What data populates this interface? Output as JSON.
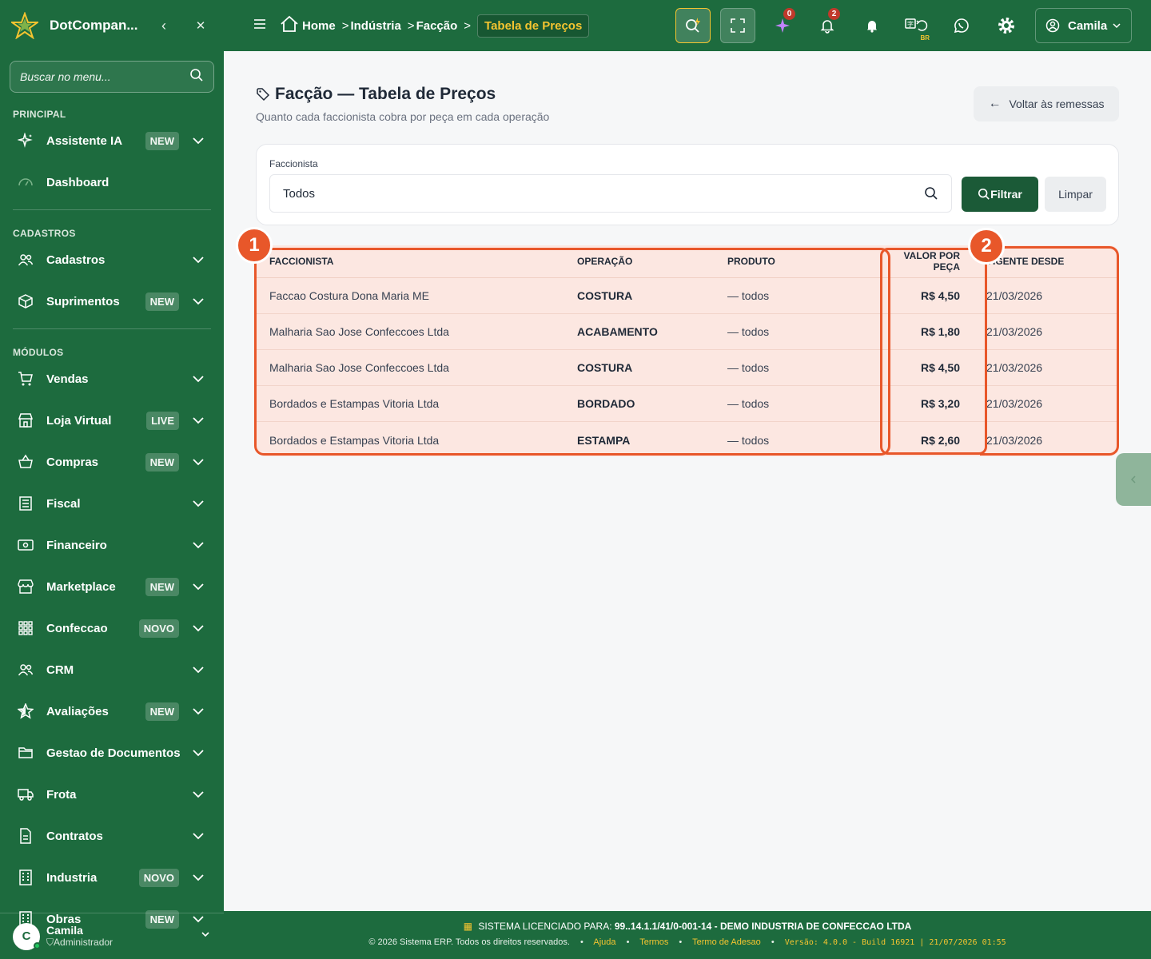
{
  "sidebar": {
    "brand": "DotCompan...",
    "search_placeholder": "Buscar no menu...",
    "sections": {
      "principal": "PRINCIPAL",
      "cadastros": "CADASTROS",
      "modulos": "MÓDULOS"
    },
    "items": [
      {
        "label": "Assistente IA",
        "badge": "NEW",
        "icon": "sparkles-icon"
      },
      {
        "label": "Dashboard",
        "badge": "",
        "icon": "gauge-icon"
      },
      {
        "label": "Cadastros",
        "badge": "",
        "icon": "users-icon"
      },
      {
        "label": "Suprimentos",
        "badge": "NEW",
        "icon": "box-icon"
      },
      {
        "label": "Vendas",
        "badge": "",
        "icon": "cart-icon"
      },
      {
        "label": "Loja Virtual",
        "badge": "LIVE",
        "icon": "store-icon"
      },
      {
        "label": "Compras",
        "badge": "NEW",
        "icon": "basket-icon"
      },
      {
        "label": "Fiscal",
        "badge": "",
        "icon": "receipt-icon"
      },
      {
        "label": "Financeiro",
        "badge": "",
        "icon": "money-icon"
      },
      {
        "label": "Marketplace",
        "badge": "NEW",
        "icon": "shop-icon"
      },
      {
        "label": "Confeccao",
        "badge": "NOVO",
        "icon": "grid-icon"
      },
      {
        "label": "CRM",
        "badge": "",
        "icon": "users-icon"
      },
      {
        "label": "Avaliações",
        "badge": "NEW",
        "icon": "star-icon"
      },
      {
        "label": "Gestao de Documentos",
        "badge": "",
        "icon": "folder-icon"
      },
      {
        "label": "Frota",
        "badge": "",
        "icon": "truck-icon"
      },
      {
        "label": "Contratos",
        "badge": "",
        "icon": "file-icon"
      },
      {
        "label": "Industria",
        "badge": "NOVO",
        "icon": "building-icon"
      },
      {
        "label": "Obras",
        "badge": "NEW",
        "icon": "building-icon"
      }
    ],
    "user": {
      "initial": "C",
      "name": "Camila",
      "role": "Administrador"
    }
  },
  "topbar": {
    "breadcrumb": [
      "Home",
      "Indústria",
      "Facção"
    ],
    "breadcrumb_active": "Tabela de Preços",
    "badge_ai": "0",
    "badge_notif": "2",
    "lang": "BR",
    "user": "Camila"
  },
  "page": {
    "title": "Facção — Tabela de Preços",
    "subtitle": "Quanto cada faccionista cobra por peça em cada operação",
    "back_button": "Voltar às remessas"
  },
  "filter": {
    "label": "Faccionista",
    "value": "Todos",
    "filter_button": "Filtrar",
    "clear_button": "Limpar"
  },
  "table": {
    "headers": [
      "FACCIONISTA",
      "OPERAÇÃO",
      "PRODUTO",
      "VALOR POR PEÇA",
      "VIGENTE DESDE"
    ],
    "rows": [
      {
        "faccionista": "Faccao Costura Dona Maria ME",
        "operacao": "COSTURA",
        "produto": "— todos",
        "valor": "R$ 4,50",
        "desde": "21/03/2026"
      },
      {
        "faccionista": "Malharia Sao Jose Confeccoes Ltda",
        "operacao": "ACABAMENTO",
        "produto": "— todos",
        "valor": "R$ 1,80",
        "desde": "21/03/2026"
      },
      {
        "faccionista": "Malharia Sao Jose Confeccoes Ltda",
        "operacao": "COSTURA",
        "produto": "— todos",
        "valor": "R$ 4,50",
        "desde": "21/03/2026"
      },
      {
        "faccionista": "Bordados e Estampas Vitoria Ltda",
        "operacao": "BORDADO",
        "produto": "— todos",
        "valor": "R$ 3,20",
        "desde": "21/03/2026"
      },
      {
        "faccionista": "Bordados e Estampas Vitoria Ltda",
        "operacao": "ESTAMPA",
        "produto": "— todos",
        "valor": "R$ 2,60",
        "desde": "21/03/2026"
      }
    ]
  },
  "annotations": [
    "1",
    "2"
  ],
  "footer": {
    "license_label": "SISTEMA LICENCIADO PARA:",
    "license_value": "99..14.1.1/41/0-001-14 - DEMO INDUSTRIA DE CONFECCAO LTDA",
    "copyright": "© 2026 Sistema ERP. Todos os direitos reservados.",
    "links": [
      "Ajuda",
      "Termos",
      "Termo de Adesao"
    ],
    "version": "Versão: 4.0.0 - Build 16921 | 21/07/2026 01:55"
  },
  "colors": {
    "primary": "#1d6b3e",
    "accent": "#f4c430",
    "highlight": "#e8572a",
    "row_bg": "#fce7e1"
  }
}
